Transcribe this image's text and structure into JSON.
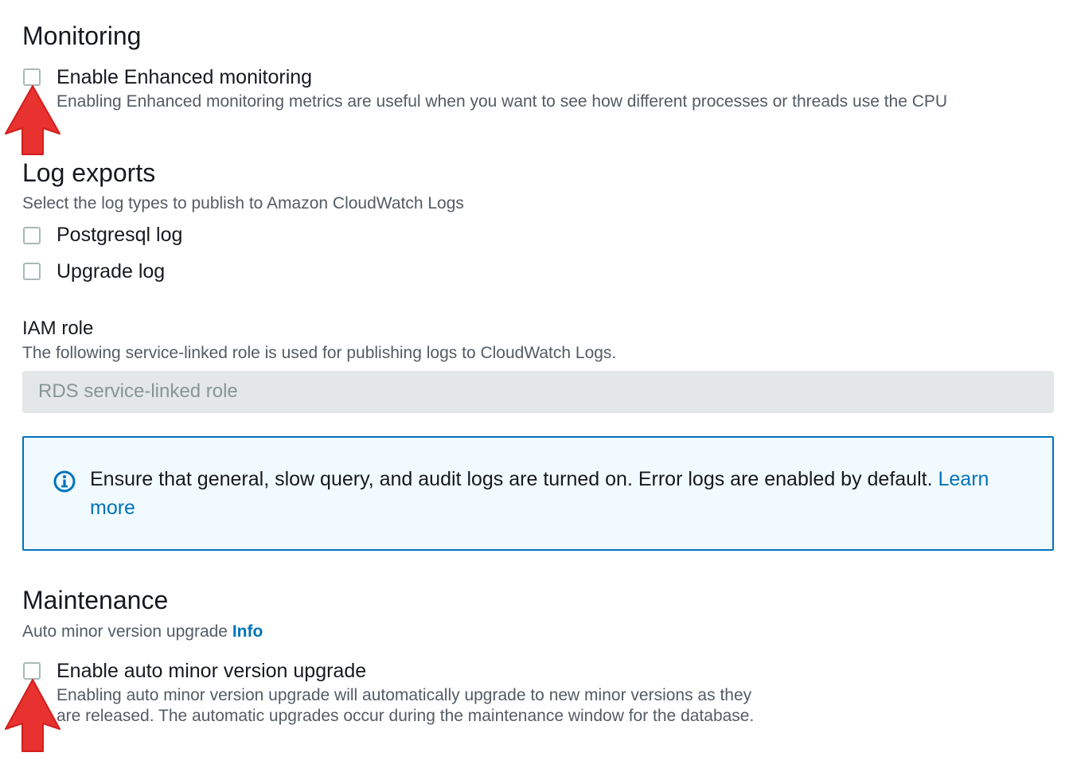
{
  "monitoring": {
    "title": "Monitoring",
    "enhanced_label": "Enable Enhanced monitoring",
    "enhanced_desc": "Enabling Enhanced monitoring metrics are useful when you want to see how different processes or threads use the CPU",
    "enhanced_checked": false
  },
  "log_exports": {
    "title": "Log exports",
    "desc": "Select the log types to publish to Amazon CloudWatch Logs",
    "options": [
      {
        "label": "Postgresql log",
        "checked": false
      },
      {
        "label": "Upgrade log",
        "checked": false
      }
    ]
  },
  "iam_role": {
    "title": "IAM role",
    "desc": "The following service-linked role is used for publishing logs to CloudWatch Logs.",
    "value": "RDS service-linked role"
  },
  "alert": {
    "icon": "info-icon",
    "text": "Ensure that general, slow query, and audit logs are turned on. Error logs are enabled by default.",
    "link_label": "Learn more"
  },
  "maintenance": {
    "title": "Maintenance",
    "sublabel": "Auto minor version upgrade",
    "info_label": "Info",
    "auto_upgrade_label": "Enable auto minor version upgrade",
    "auto_upgrade_desc": "Enabling auto minor version upgrade will automatically upgrade to new minor versions as they are released. The automatic upgrades occur during the maintenance window for the database.",
    "auto_upgrade_checked": false
  },
  "colors": {
    "accent": "#0073bb",
    "annotation_arrow": "#e8322f",
    "alert_background": "#f1faff"
  },
  "annotations": [
    "red-arrow-icon",
    "red-arrow-icon"
  ]
}
